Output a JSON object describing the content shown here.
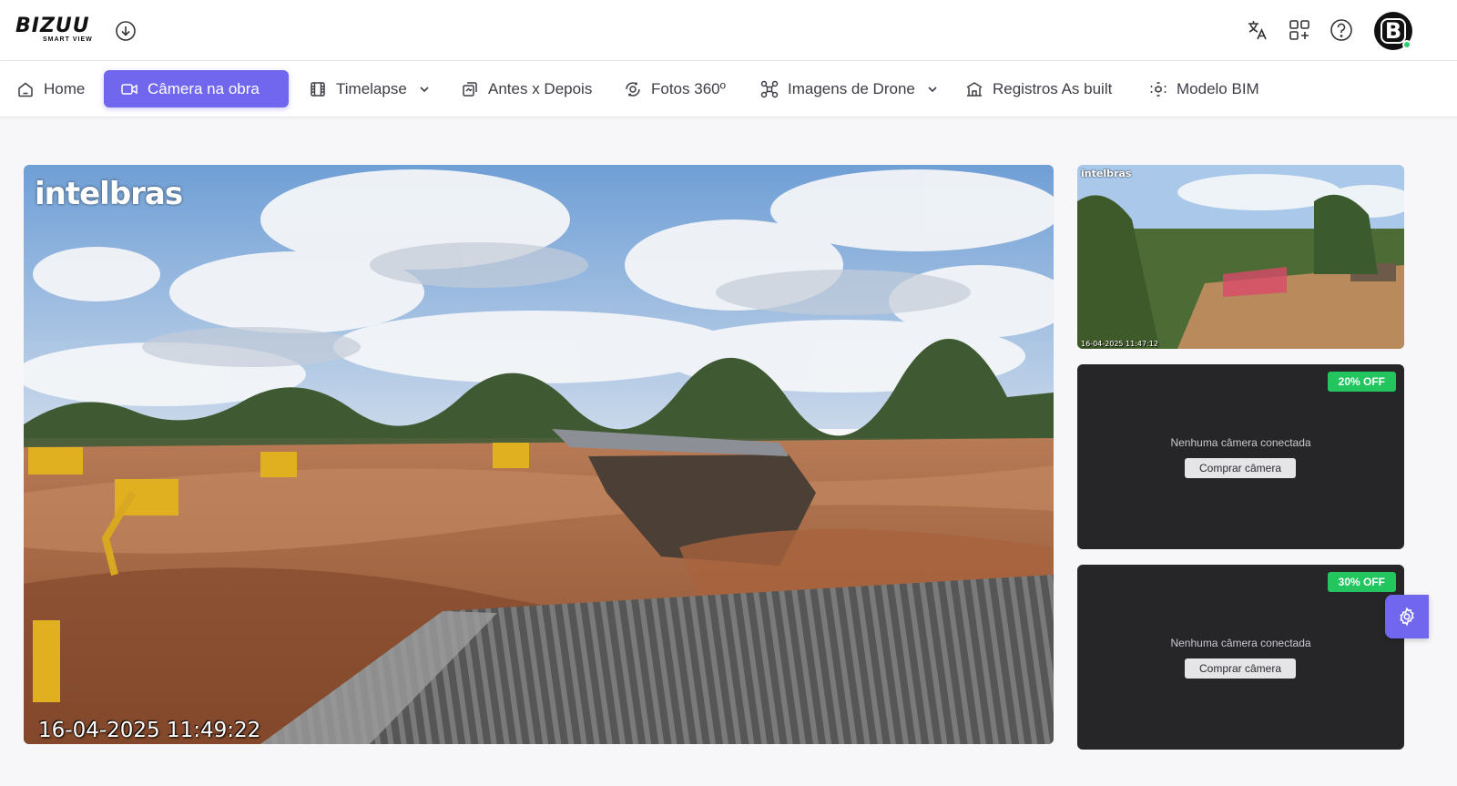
{
  "header": {
    "logo_text": "BIZUU",
    "logo_subtext": "SMART VIEW",
    "icons": [
      "download-circle-icon",
      "translate-icon",
      "apps-add-icon",
      "help-circle-icon"
    ],
    "avatar_letter": "B",
    "online_status_color": "#2ecc71"
  },
  "nav": {
    "active_color": "#7166ee",
    "items": [
      {
        "label": "Home",
        "icon": "home-icon"
      },
      {
        "label": "Câmera na obra",
        "icon": "video-camera-icon",
        "active": true
      },
      {
        "label": "Timelapse",
        "icon": "film-icon",
        "dropdown": true
      },
      {
        "label": "Antes x Depois",
        "icon": "compare-icon"
      },
      {
        "label": "Fotos 360º",
        "icon": "camera-360-icon"
      },
      {
        "label": "Imagens de Drone",
        "icon": "drone-icon",
        "dropdown": true
      },
      {
        "label": "Registros As built",
        "icon": "building-icon"
      },
      {
        "label": "Modelo BIM",
        "icon": "bim-model-icon"
      }
    ]
  },
  "main_camera": {
    "brand": "intelbras",
    "timestamp": "16-04-2025 11:49:22"
  },
  "side_cameras": {
    "thumb": {
      "brand": "intelbras",
      "timestamp": "16-04-2025 11:47:12"
    },
    "empty1": {
      "badge": "20% OFF",
      "message": "Nenhuma câmera conectada",
      "button": "Comprar câmera"
    },
    "empty2": {
      "badge": "30% OFF",
      "message": "Nenhuma câmera conectada",
      "button": "Comprar câmera"
    },
    "badge_color": "#22c55e"
  },
  "settings_fab_icon": "gear-icon"
}
